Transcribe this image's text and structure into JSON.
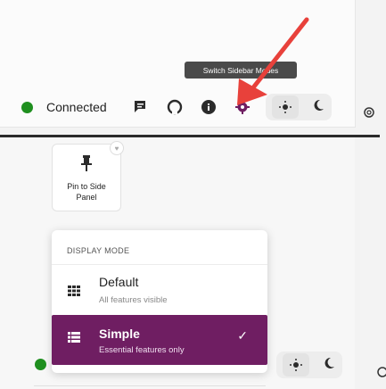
{
  "tooltip": {
    "text": "Switch Sidebar Modes"
  },
  "toolbar": {
    "status_label": "Connected",
    "status_color": "#1f8f1f",
    "icons": [
      "chat-icon",
      "github-icon",
      "info-icon",
      "gear-icon"
    ],
    "theme_icons": [
      "sun-icon",
      "moon-icon"
    ]
  },
  "pin_card": {
    "label": "Pin to Side Panel",
    "icon": "pin-icon"
  },
  "menu": {
    "header": "DISPLAY MODE",
    "items": [
      {
        "title": "Default",
        "description": "All features visible",
        "icon": "grid-icon",
        "selected": false
      },
      {
        "title": "Simple",
        "description": "Essential features only",
        "icon": "list-icon",
        "selected": true
      }
    ]
  },
  "accent_color": "#6f1e62",
  "annotation_arrow_color": "#e8413b"
}
